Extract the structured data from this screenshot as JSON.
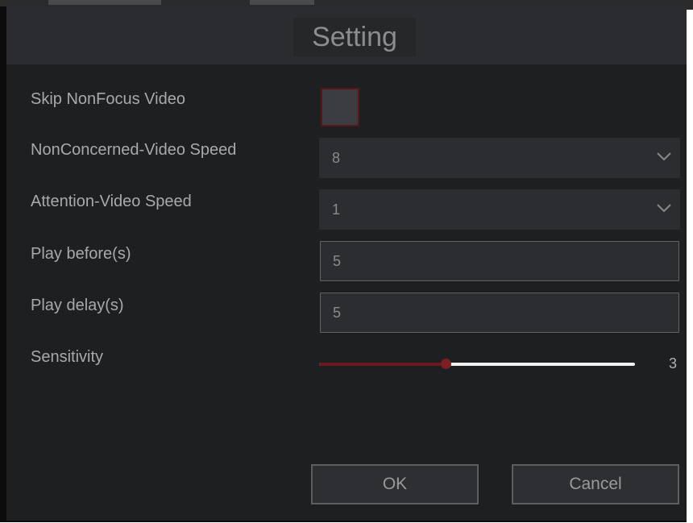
{
  "dialog": {
    "title": "Setting"
  },
  "settings": {
    "skip_nonfocus": {
      "label": "Skip NonFocus Video",
      "checked": false
    },
    "nonconcerned_speed": {
      "label": "NonConcerned-Video Speed",
      "value": "8"
    },
    "attention_speed": {
      "label": "Attention-Video Speed",
      "value": "1"
    },
    "play_before": {
      "label": "Play before(s)",
      "value": "5"
    },
    "play_delay": {
      "label": "Play delay(s)",
      "value": "5"
    },
    "sensitivity": {
      "label": "Sensitivity",
      "value": "3",
      "level_fraction": 0.4
    }
  },
  "buttons": {
    "ok": "OK",
    "cancel": "Cancel"
  },
  "icons": {
    "dropdown": "chevron-down-icon",
    "checkbox": "checkbox-unchecked"
  },
  "colors": {
    "background": "#1e1f21",
    "titlebar": "#2b2c2f",
    "accent_dark_red": "#6a1a1d",
    "text": "#a9a9a9"
  }
}
